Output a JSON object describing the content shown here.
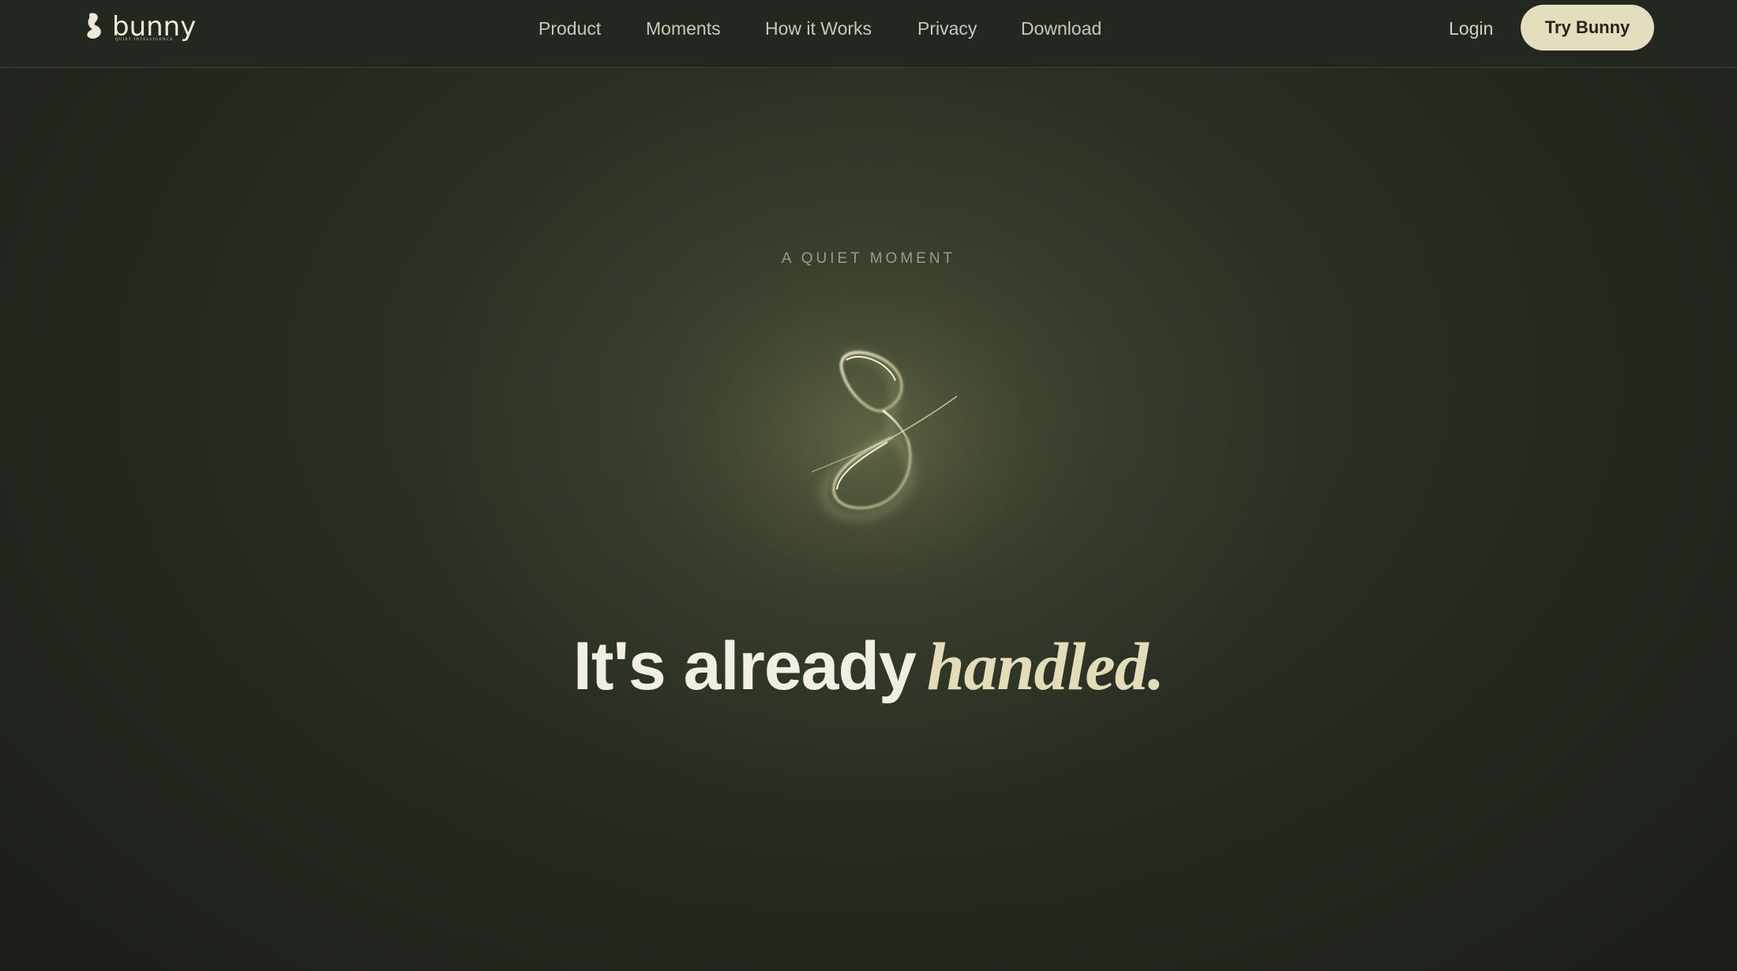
{
  "brand": {
    "name": "bunny",
    "tagline": "QUIET INTELLIGENCE",
    "icon": "bunny-logo-icon"
  },
  "nav": {
    "items": [
      {
        "label": "Product"
      },
      {
        "label": "Moments"
      },
      {
        "label": "How it Works"
      },
      {
        "label": "Privacy"
      },
      {
        "label": "Download"
      }
    ],
    "login_label": "Login",
    "cta_label": "Try Bunny"
  },
  "hero": {
    "eyebrow": "A QUIET MOMENT",
    "mark_icon": "glowing-ribbon-icon",
    "headline_solid": "It's already",
    "headline_script": "handled."
  },
  "colors": {
    "background": "#1d2119",
    "header": "#222720",
    "cta_bg": "#e3dfbd",
    "accent_cream": "#e2ddb6",
    "text": "#f1efe4"
  }
}
